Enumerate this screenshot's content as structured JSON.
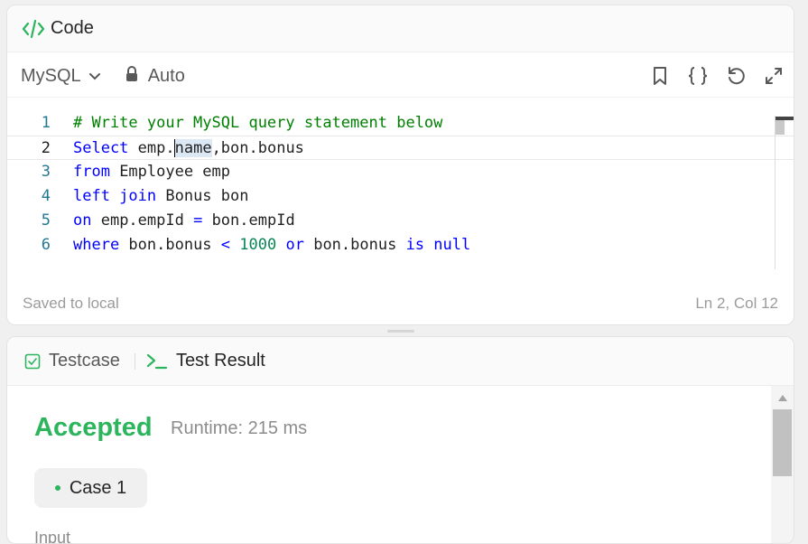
{
  "code_panel": {
    "title": "Code",
    "language": "MySQL",
    "mode": "Auto",
    "status_left": "Saved to local",
    "status_right": "Ln 2, Col 12",
    "lines": [
      {
        "num": "1",
        "parts": [
          {
            "cls": "cmt",
            "text": "# Write your MySQL query statement below"
          }
        ]
      },
      {
        "num": "2",
        "parts": [
          {
            "cls": "kw",
            "text": "Select"
          },
          {
            "cls": "txt",
            "text": " emp."
          },
          {
            "cls": "caret",
            "text": ""
          },
          {
            "cls": "txt sel",
            "text": "name"
          },
          {
            "cls": "txt",
            "text": ",bon.bonus"
          }
        ]
      },
      {
        "num": "3",
        "parts": [
          {
            "cls": "kw",
            "text": "from"
          },
          {
            "cls": "txt",
            "text": " Employee emp"
          }
        ]
      },
      {
        "num": "4",
        "parts": [
          {
            "cls": "kw",
            "text": "left join"
          },
          {
            "cls": "txt",
            "text": " Bonus bon"
          }
        ]
      },
      {
        "num": "5",
        "parts": [
          {
            "cls": "kw",
            "text": "on"
          },
          {
            "cls": "txt",
            "text": " emp.empId "
          },
          {
            "cls": "kw",
            "text": "="
          },
          {
            "cls": "txt",
            "text": " bon.empId"
          }
        ]
      },
      {
        "num": "6",
        "parts": [
          {
            "cls": "kw",
            "text": "where"
          },
          {
            "cls": "txt",
            "text": " bon.bonus "
          },
          {
            "cls": "kw",
            "text": "<"
          },
          {
            "cls": "txt",
            "text": " "
          },
          {
            "cls": "num",
            "text": "1000"
          },
          {
            "cls": "txt",
            "text": " "
          },
          {
            "cls": "kw",
            "text": "or"
          },
          {
            "cls": "txt",
            "text": " bon.bonus "
          },
          {
            "cls": "kw",
            "text": "is"
          },
          {
            "cls": "txt",
            "text": " "
          },
          {
            "cls": "kw",
            "text": "null"
          }
        ]
      }
    ],
    "icons": [
      "chevron-down-icon",
      "lock-icon",
      "bookmark-icon",
      "format-braces-icon",
      "reset-icon",
      "expand-icon",
      "code-icon"
    ]
  },
  "result_panel": {
    "tabs": [
      {
        "label": "Testcase",
        "icon": "checkbox-icon"
      },
      {
        "label": "Test Result",
        "icon": "terminal-icon"
      }
    ],
    "status": "Accepted",
    "runtime": "Runtime: 215 ms",
    "case_label": "Case 1",
    "input_label": "Input"
  },
  "colors": {
    "accent_green": "#2db55d",
    "keyword": "#0000ff",
    "comment": "#008000",
    "number": "#098658"
  }
}
